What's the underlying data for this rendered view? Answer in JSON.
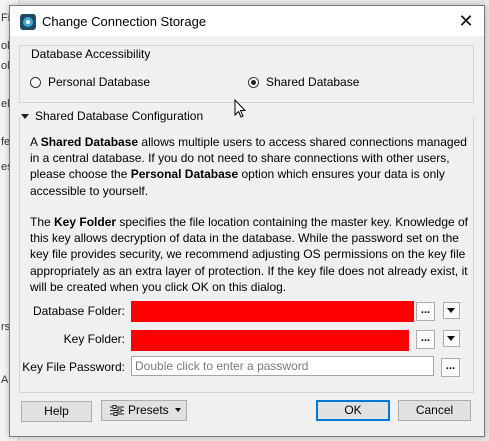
{
  "background_fragments": [
    "Fil",
    "ol",
    "ol",
    "fe",
    "es'",
    "el",
    "rs",
    "AC"
  ],
  "window": {
    "title": "Change Connection Storage",
    "close_glyph": "✕"
  },
  "accessibility": {
    "group_label": "Database Accessibility",
    "options": [
      {
        "label": "Personal Database",
        "selected": false
      },
      {
        "label": "Shared Database",
        "selected": true
      }
    ]
  },
  "config": {
    "header": "Shared Database Configuration",
    "para1": {
      "prefix": "A ",
      "bold1": "Shared Database",
      "middle": " allows multiple users to access shared connections managed in a central database. If you do not need to share connections with other users, please choose the ",
      "bold2": "Personal Database",
      "suffix": " option which ensures your data is only accessible to yourself."
    },
    "para2": {
      "prefix": "The ",
      "bold1": "Key Folder",
      "rest": " specifies the file location containing the master key. Knowledge of this key allows decryption of data in the database. While the password set on the key file provides security, we recommend adjusting OS permissions on the key file appropriately as an extra layer of protection. If the key file does not already exist, it will be created when you click OK on this dialog."
    },
    "fields": {
      "database_folder_label": "Database Folder:",
      "key_folder_label": "Key Folder:",
      "key_file_password_label": "Key File Password:",
      "password_placeholder": "Double click to enter a password",
      "browse_glyph": "...",
      "redaction_color": "#ff0000"
    }
  },
  "footer": {
    "help_label": "Help",
    "presets_label": "Presets",
    "ok_label": "OK",
    "cancel_label": "Cancel"
  },
  "colors": {
    "accent": "#0078d7",
    "dialog_bg": "#f0f0f0"
  }
}
